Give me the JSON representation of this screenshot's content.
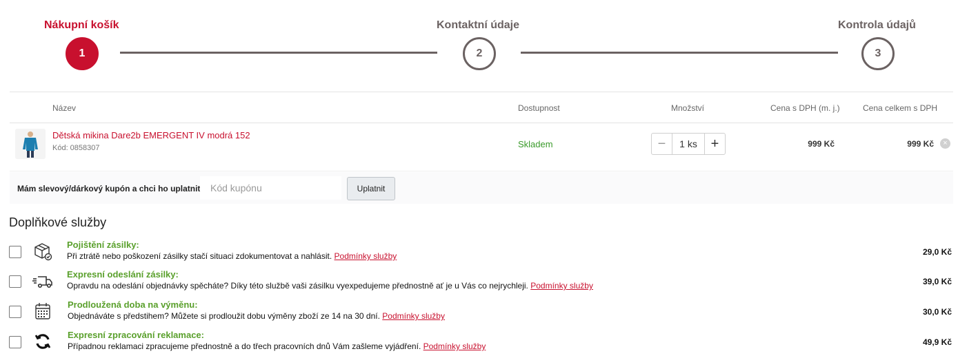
{
  "steps": [
    {
      "label": "Nákupní košík",
      "number": "1"
    },
    {
      "label": "Kontaktní údaje",
      "number": "2"
    },
    {
      "label": "Kontrola údajů",
      "number": "3"
    }
  ],
  "cart": {
    "headers": {
      "name": "Název",
      "availability": "Dostupnost",
      "quantity": "Množství",
      "unit_price": "Cena s DPH (m. j.)",
      "total_price": "Cena celkem s DPH"
    },
    "item": {
      "name": "Dětská mikina Dare2b EMERGENT IV modrá 152",
      "code": "Kód: 0858307",
      "availability": "Skladem",
      "quantity": "1 ks",
      "unit_price": "999 Kč",
      "total_price": "999 Kč"
    }
  },
  "coupon": {
    "label": "Mám slevový/dárkový kupón a chci ho uplatnit:",
    "placeholder": "Kód kupónu",
    "button": "Uplatnit"
  },
  "services": {
    "title": "Doplňkové služby",
    "link_text": "Podmínky služby",
    "items": [
      {
        "icon": "package-shield-icon",
        "title": "Pojištění zásilky:",
        "desc": "Při ztrátě nebo poškození zásilky stačí situaci zdokumentovat a nahlásit.",
        "price": "29,0 Kč"
      },
      {
        "icon": "truck-fast-icon",
        "title": "Expresní odeslání zásilky:",
        "desc": "Opravdu na odeslání objednávky spěcháte? Díky této službě vaši zásilku vyexpedujeme přednostně ať je u Vás co nejrychleji.",
        "price": "39,0 Kč"
      },
      {
        "icon": "calendar-icon",
        "title": "Prodloužená doba na výměnu:",
        "desc": "Objednáváte s předstihem? Můžete si prodloužit dobu výměny zboží ze 14 na 30 dní.",
        "price": "30,0 Kč"
      },
      {
        "icon": "refresh-icon",
        "title": "Expresní zpracování reklamace:",
        "desc": "Případnou reklamaci zpracujeme přednostně a do třech pracovních dnů Vám zašleme vyjádření.",
        "price": "49,9 Kč"
      }
    ]
  }
}
